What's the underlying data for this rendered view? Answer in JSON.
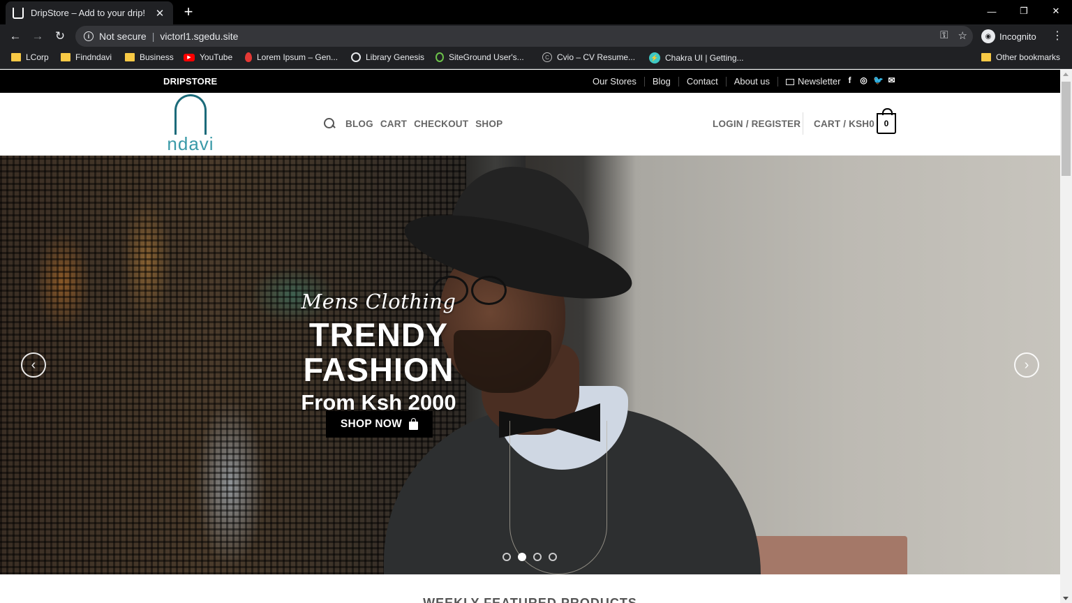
{
  "browser": {
    "tab_title": "DripStore – Add to your drip!",
    "tab_close": "✕",
    "new_tab": "+",
    "controls": {
      "minimize": "—",
      "restore": "❐",
      "close": "✕"
    },
    "nav": {
      "back": "←",
      "forward": "→",
      "reload": "↻"
    },
    "security_label": "Not secure",
    "url": "victorl1.sgedu.site",
    "omni_icons": {
      "key": "⚿",
      "star": "☆"
    },
    "profile_label": "Incognito",
    "menu": "⋮",
    "bookmarks": [
      {
        "label": "LCorp",
        "icon": "folder-icon"
      },
      {
        "label": "Findndavi",
        "icon": "folder-icon"
      },
      {
        "label": "Business",
        "icon": "folder-icon"
      },
      {
        "label": "YouTube",
        "icon": "youtube-icon"
      },
      {
        "label": "Lorem Ipsum – Gen...",
        "icon": "pin-icon"
      },
      {
        "label": "Library Genesis",
        "icon": "globe-icon"
      },
      {
        "label": "SiteGround User's...",
        "icon": "siteground-icon"
      },
      {
        "label": "Cvio – CV Resume...",
        "icon": "copyright-icon"
      },
      {
        "label": "Chakra UI | Getting...",
        "icon": "chakra-icon"
      }
    ],
    "other_bookmarks": "Other bookmarks"
  },
  "site": {
    "topbar": {
      "brand": "DRIPSTORE",
      "links": [
        "Our Stores",
        "Blog",
        "Contact",
        "About us",
        "Newsletter"
      ],
      "social": [
        "f",
        "◎",
        "🐦",
        "✉"
      ]
    },
    "logo_text": "ndavi",
    "nav": [
      "BLOG",
      "CART",
      "CHECKOUT",
      "SHOP"
    ],
    "account_label": "LOGIN / REGISTER",
    "cart_label": "CART / KSH0",
    "cart_count": "0",
    "hero": {
      "script": "Mens Clothing",
      "title": "TRENDY FASHION",
      "subtitle": "From Ksh 2000",
      "button": "SHOP NOW",
      "prev": "‹",
      "next": "›",
      "slides": 4,
      "active_slide": 2
    },
    "next_section_title": "WEEKLY FEATURED PRODUCTS"
  }
}
